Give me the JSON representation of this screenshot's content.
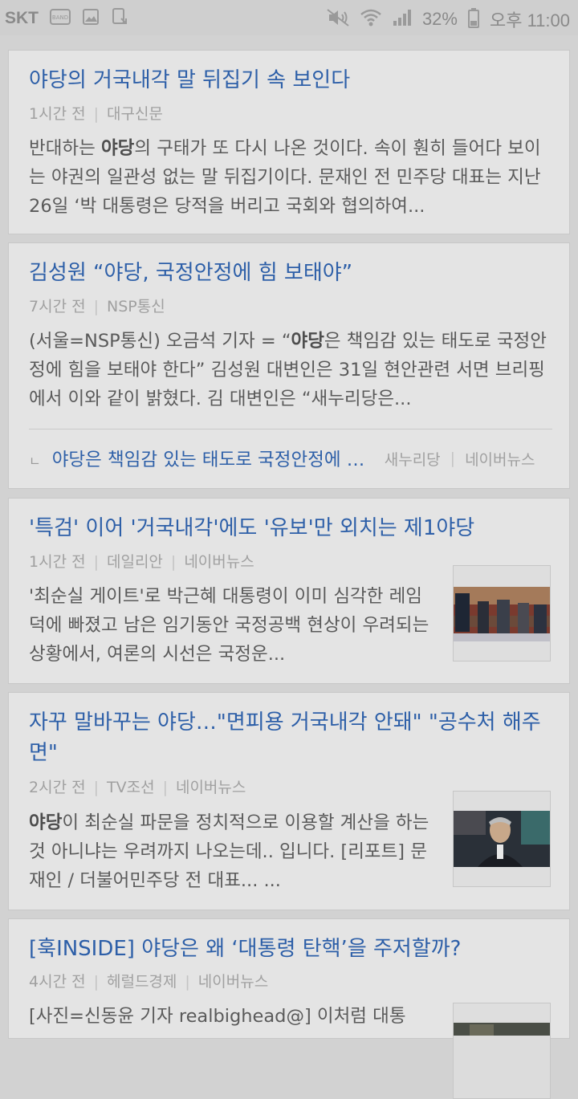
{
  "status_bar": {
    "carrier": "SKT",
    "battery": "32%",
    "time": "오후 11:00",
    "icons": [
      "band-icon",
      "gallery-icon",
      "download-icon",
      "mute-icon",
      "wifi-icon",
      "signal-icon",
      "battery-icon"
    ]
  },
  "articles": [
    {
      "title_hl": "야당",
      "title_rest": "의 거국내각 말 뒤집기 속 보인다",
      "time": "1시간 전",
      "source": "대구신문",
      "body_pre": "반대하는 ",
      "body_hl": "야당",
      "body_post": "의 구태가 또 다시 나온 것이다. 속이 훤히 들어다 보이는 야권의 일관성 없는 말 뒤집기이다. 문재인 전 민주당 대표는 지난 26일 ‘박 대통령은 당적을 버리고 국회와 협의하여..."
    },
    {
      "title": "김성원 “야당, 국정안정에 힘 보태야”",
      "time": "7시간 전",
      "source": "NSP통신",
      "body_pre": "(서울=NSP통신) 오금석 기자 = “",
      "body_hl": "야당",
      "body_post": "은 책임감 있는 태도로 국정안정에 힘을 보태야 한다” 김성원 대변인은 31일 현안관련 서면 브리핑에서 이와 같이 밝혔다. 김 대변인은 “새누리당은...",
      "related": {
        "arrow": "ㄴ",
        "title": "야당은 책임감 있는 태도로 국정안정에 힘을 보태야",
        "source": "새누리당",
        "portal": "네이버뉴스"
      }
    },
    {
      "title": "'특검' 이어 '거국내각'에도 '유보'만 외치는 제1야당",
      "time": "1시간 전",
      "source": "데일리안",
      "portal": "네이버뉴스",
      "body": "'최순실 게이트'로 박근혜 대통령이 이미 심각한 레임덕에 빠졌고 남은 임기동안 국정공백 현상이 우려되는 상황에서, 여론의 시선은 국정운..."
    },
    {
      "title": "자꾸 말바꾸는 야당…\"면피용 거국내각 안돼\" \"공수처 해주면\"",
      "time": "2시간 전",
      "source": "TV조선",
      "portal": "네이버뉴스",
      "body_hl": "야당",
      "body_post": "이 최순실 파문을 정치적으로 이용할 계산을 하는 것 아니냐는 우려까지 나오는데.. 입니다. [리포트] 문재인 / 더불어민주당 전 대표... ..."
    },
    {
      "title": "[훅INSIDE] 야당은 왜 ‘대통령 탄핵’을 주저할까?",
      "time": "4시간 전",
      "source": "헤럴드경제",
      "portal": "네이버뉴스",
      "body": "[사진=신동윤 기자 realbighead@] 이처럼 대통"
    }
  ]
}
